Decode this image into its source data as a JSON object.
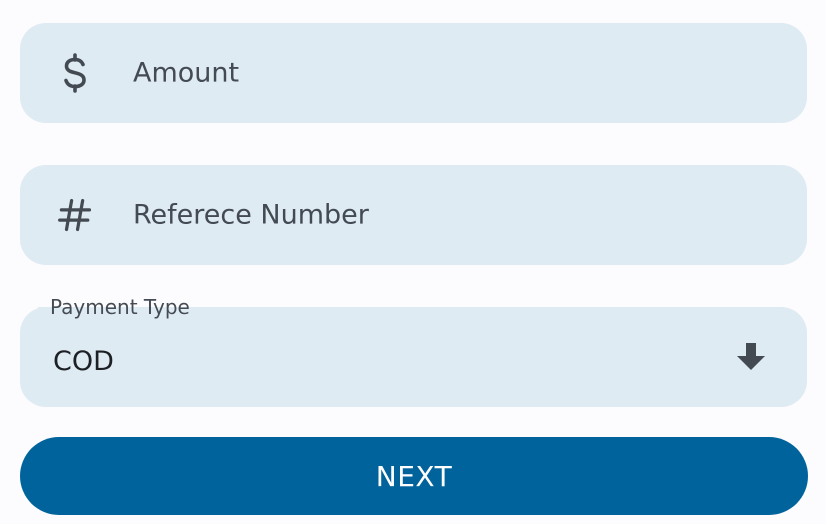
{
  "amount_field": {
    "icon": "dollar-icon",
    "placeholder": "Amount"
  },
  "reference_field": {
    "icon": "hash-icon",
    "placeholder": "Referece Number"
  },
  "payment_type": {
    "label": "Payment Type",
    "selected_value": "COD",
    "icon": "arrow-down-icon"
  },
  "next_button": {
    "label": "NEXT"
  },
  "colors": {
    "background": "#fcfbfd",
    "field_background": "#deebf3",
    "button_background": "#00639b",
    "button_text": "#ffffff",
    "icon": "#444a52"
  }
}
